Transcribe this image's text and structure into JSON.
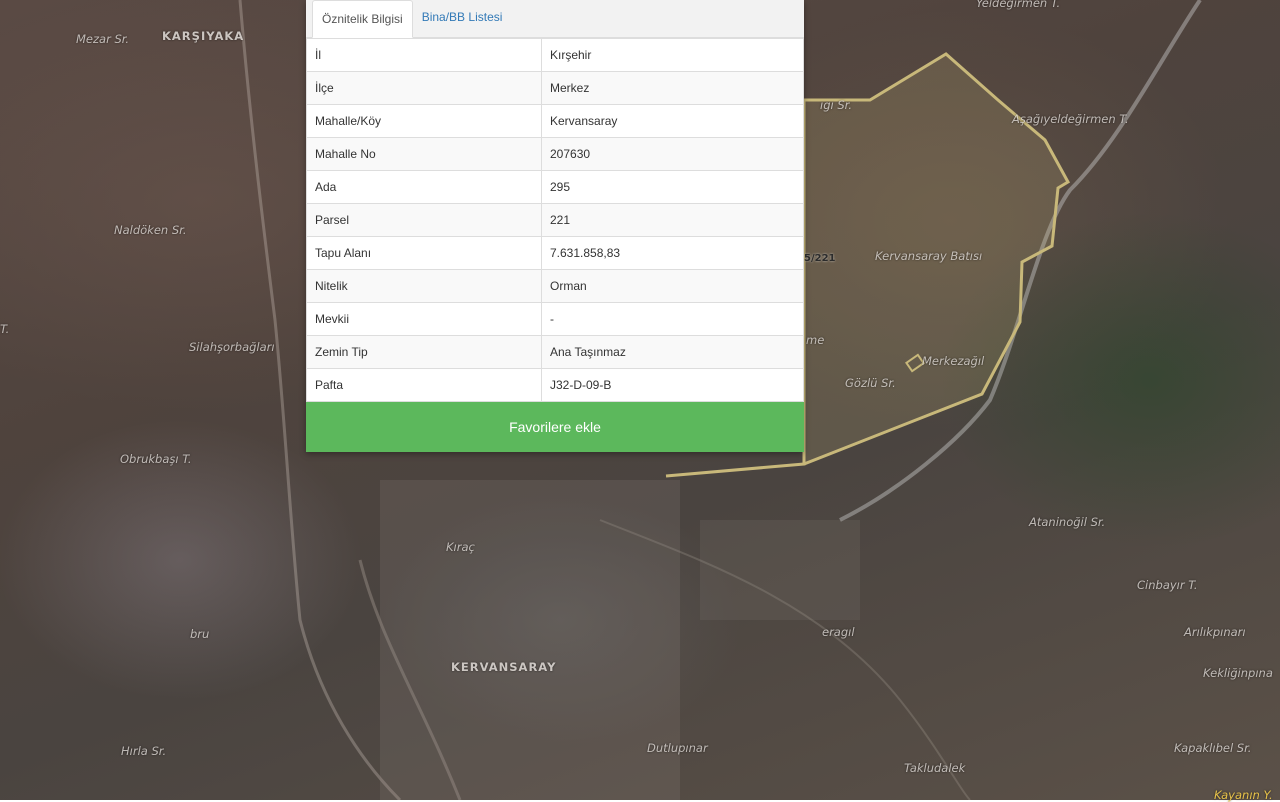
{
  "tabs": {
    "attributes": "Öznitelik Bilgisi",
    "buildings": "Bina/BB Listesi"
  },
  "attributes": [
    {
      "key": "İl",
      "value": "Kırşehir"
    },
    {
      "key": "İlçe",
      "value": "Merkez"
    },
    {
      "key": "Mahalle/Köy",
      "value": "Kervansaray"
    },
    {
      "key": "Mahalle No",
      "value": "207630"
    },
    {
      "key": "Ada",
      "value": "295"
    },
    {
      "key": "Parsel",
      "value": "221"
    },
    {
      "key": "Tapu Alanı",
      "value": "7.631.858,83"
    },
    {
      "key": "Nitelik",
      "value": "Orman"
    },
    {
      "key": "Mevkii",
      "value": "-"
    },
    {
      "key": "Zemin Tip",
      "value": "Ana Taşınmaz"
    },
    {
      "key": "Pafta",
      "value": "J32-D-09-B"
    }
  ],
  "favorite_button": "Favorilere ekle",
  "map": {
    "labels": {
      "mezar": "Mezar Sr.",
      "karsiyaka": "KARŞIYAKA",
      "yeldegirmen": "Yeldeğirmen T.",
      "asagiyel": "Aşağıyeldeğirmen T.",
      "naldoken": "Naldöken Sr.",
      "kervansaray_batisi": "Kervansaray Batısı",
      "silahsor": "Silahşorbağları",
      "merkezagil": "Merkezağıl",
      "gozlu": "Gözlü Sr.",
      "obrukbasi": "Obrukbaşı T.",
      "atanin": "Ataninoğil Sr.",
      "cinbayir": "Cinbayır T.",
      "arilik": "Arılıkpınarı",
      "kekligin": "Kekliğinpına",
      "kervansaray": "KERVANSARAY",
      "kirac": "Kıraç",
      "hirla": "Hırla Sr.",
      "dutlupinar": "Dutlupınar",
      "takludalek": "Takludalek",
      "kapaklibel": "Kapaklıbel Sr.",
      "kayanin": "Kayanın Y.",
      "gi_sr": "ıgı Sr.",
      "me": "me",
      "oruk": "bru",
      "eragili": "eragıl",
      "t_left": "T.",
      "parcel": "5/221"
    },
    "parcel_boundary_color": "#c8b87a"
  }
}
